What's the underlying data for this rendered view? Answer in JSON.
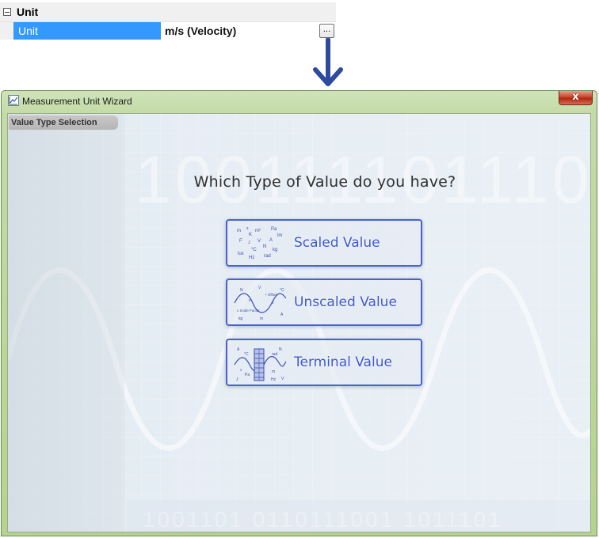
{
  "property_grid": {
    "category_label": "Unit",
    "row_name": "Unit",
    "row_value": "m/s (Velocity)",
    "ellipsis_label": "..."
  },
  "window": {
    "title": "Measurement Unit Wizard",
    "close_label": "x",
    "step_tab": "Value Type Selection",
    "background_digits": "1001111011101",
    "question": "Which Type of Value do you have?",
    "choices": [
      {
        "label": "Scaled Value",
        "icon": "physical-units-icon"
      },
      {
        "label": "Unscaled Value",
        "icon": "waveform-scale-offset-icon"
      },
      {
        "label": "Terminal Value",
        "icon": "terminal-block-icon"
      }
    ],
    "scaled_icon_glyphs": [
      "m",
      "s",
      "m²",
      "Pa",
      "K",
      "lm",
      "F",
      "J",
      "V",
      "A",
      "N",
      "°C",
      "kg",
      "lux",
      "Hz",
      "rad"
    ],
    "unscaled_icon_glyphs": [
      "N",
      "V",
      "°C",
      "+ Offset",
      "s",
      "J",
      "x Scale Factor",
      "A",
      "kg",
      "m"
    ],
    "terminal_icon_glyphs": [
      "A",
      "°C",
      "N",
      "rad",
      "s",
      "Pa",
      "m",
      "J",
      "Hz",
      "V"
    ]
  },
  "colors": {
    "accent_blue": "#3d58cf",
    "selection_blue": "#3399ff",
    "arrow_blue": "#2e4a9e",
    "window_frame_green": "#b6d38d"
  }
}
